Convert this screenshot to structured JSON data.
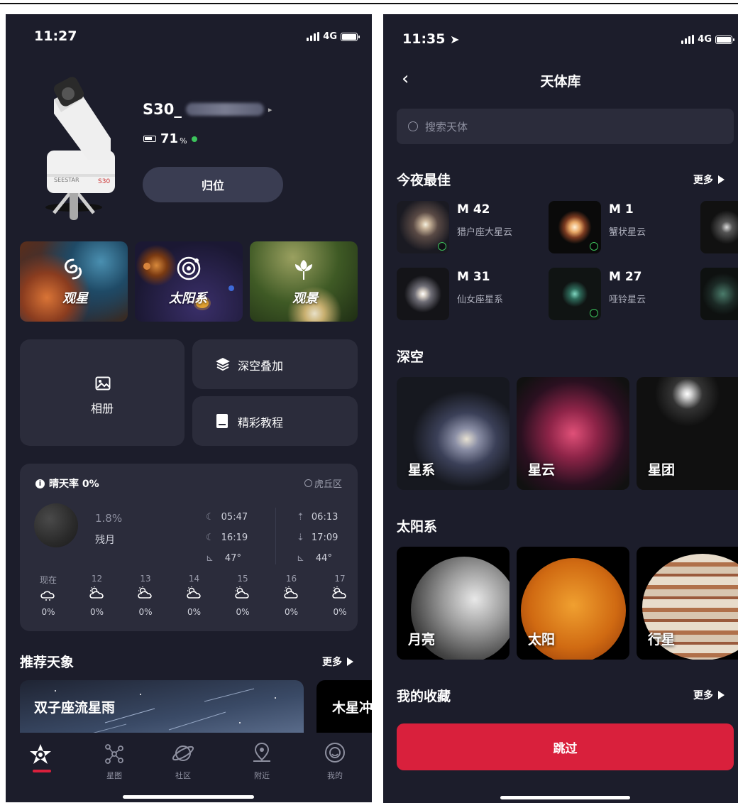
{
  "left": {
    "status": {
      "time": "11:27",
      "network": "4G"
    },
    "device": {
      "name": "S30_",
      "battery": "71",
      "battery_unit": "%",
      "home_button": "归位"
    },
    "modes": [
      {
        "label": "观星",
        "icon": "galaxy-icon"
      },
      {
        "label": "太阳系",
        "icon": "orbit-icon"
      },
      {
        "label": "观景",
        "icon": "flower-icon"
      }
    ],
    "tools": {
      "album": "相册",
      "deep_stack": "深空叠加",
      "tutorial": "精彩教程"
    },
    "weather": {
      "clear_rate": "晴天率 0%",
      "location": "虎丘区",
      "moon_pct": "1.8%",
      "moon_phase": "残月",
      "moonrise": "05:47",
      "moonset": "16:19",
      "moon_alt": "47°",
      "sunrise": "06:13",
      "sunset": "17:09",
      "sun_alt": "44°",
      "hours": [
        {
          "label": "现在",
          "pct": "0%"
        },
        {
          "label": "12",
          "pct": "0%"
        },
        {
          "label": "13",
          "pct": "0%"
        },
        {
          "label": "14",
          "pct": "0%"
        },
        {
          "label": "15",
          "pct": "0%"
        },
        {
          "label": "16",
          "pct": "0%"
        },
        {
          "label": "17",
          "pct": "0%"
        }
      ]
    },
    "recommend": {
      "title": "推荐天象",
      "more": "更多",
      "events": [
        "双子座流星雨",
        "木星冲"
      ]
    },
    "nav": [
      {
        "label": "",
        "icon": "home-star-icon",
        "active": true
      },
      {
        "label": "星图",
        "icon": "star-map-icon"
      },
      {
        "label": "社区",
        "icon": "community-icon"
      },
      {
        "label": "附近",
        "icon": "nearby-icon"
      },
      {
        "label": "我的",
        "icon": "profile-icon"
      }
    ]
  },
  "right": {
    "status": {
      "time": "11:35",
      "network": "4G"
    },
    "title": "天体库",
    "search_placeholder": "搜索天体",
    "tonight": {
      "title": "今夜最佳",
      "more": "更多",
      "items": [
        {
          "name": "M 42",
          "desc": "猎户座大星云"
        },
        {
          "name": "M 1",
          "desc": "蟹状星云"
        },
        {
          "name": "M 31",
          "desc": "仙女座星系"
        },
        {
          "name": "M 27",
          "desc": "哑铃星云"
        }
      ]
    },
    "deep_sky": {
      "title": "深空",
      "items": [
        "星系",
        "星云",
        "星团"
      ]
    },
    "solar": {
      "title": "太阳系",
      "items": [
        "月亮",
        "太阳",
        "行星"
      ]
    },
    "favorites": {
      "title": "我的收藏",
      "more": "更多"
    },
    "skip_button": "跳过"
  },
  "colors": {
    "background": "#1c1d2b",
    "card": "#2b2c3b",
    "accent_red": "#d9203c",
    "green": "#3cc35c"
  }
}
